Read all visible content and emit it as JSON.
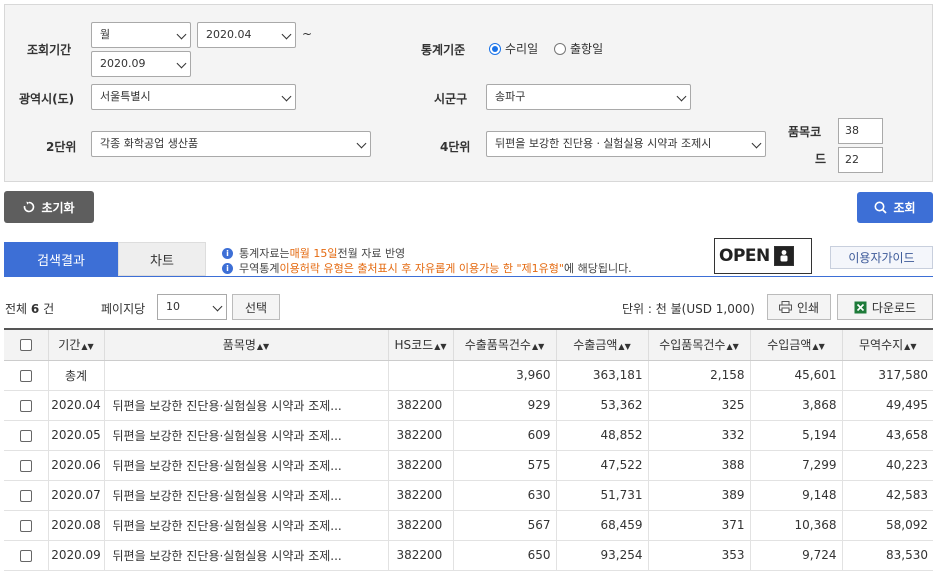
{
  "filters": {
    "period_label": "조회기간",
    "period_unit": "월",
    "period_start": "2020.04",
    "period_tilde": "~",
    "period_end": "2020.09",
    "stat_basis_label": "통계기준",
    "stat_basis_options": [
      "수리일",
      "출항일"
    ],
    "stat_basis_selected": "수리일",
    "province_label": "광역시(도)",
    "province_value": "서울특별시",
    "district_label": "시군구",
    "district_value": "송파구",
    "level2_label": "2단위",
    "level2_value": "각종 화학공업 생산품",
    "level4_label": "4단위",
    "level4_value": "뒤편을 보강한 진단용ㆍ실험실용 시약과 조제시",
    "item_code_label_1": "품목코",
    "item_code_label_2": "드",
    "item_code_1": "38",
    "item_code_2": "22"
  },
  "buttons": {
    "reset": "초기화",
    "search": "조회",
    "guide": "이용자가이드",
    "select": "선택",
    "print": "인쇄",
    "download": "다운로드"
  },
  "tabs": [
    "검색결과",
    "차트"
  ],
  "notices": {
    "line1_a": "통계자료는 ",
    "line1_b": "매월 15일",
    "line1_c": " 전월 자료 반영",
    "line2_a": "무역통계 ",
    "line2_b": "이용허락 유형은 출처표시 후 자유롭게 이용가능 한 \"제1유형\"",
    "line2_c": "에 해당됩니다."
  },
  "open_logo": {
    "word": "OPEN"
  },
  "summary": {
    "total_prefix": "전체",
    "total_count": "6",
    "total_suffix": "건",
    "per_page_label": "페이지당",
    "per_page_value": "10",
    "unit_text": "단위 : 천 불(USD 1,000)"
  },
  "table": {
    "headers": [
      "기간",
      "품목명",
      "HS코드",
      "수출품목건수",
      "수출금액",
      "수입품목건수",
      "수입금액",
      "무역수지"
    ],
    "total_row": {
      "period": "총계",
      "name": "",
      "hs": "",
      "exp_cnt": "3,960",
      "exp_amt": "363,181",
      "imp_cnt": "2,158",
      "imp_amt": "45,601",
      "balance": "317,580"
    },
    "rows": [
      {
        "period": "2020.04",
        "name": "뒤편을 보강한 진단용·실험실용 시약과 조제...",
        "hs": "382200",
        "exp_cnt": "929",
        "exp_amt": "53,362",
        "imp_cnt": "325",
        "imp_amt": "3,868",
        "balance": "49,495"
      },
      {
        "period": "2020.05",
        "name": "뒤편을 보강한 진단용·실험실용 시약과 조제...",
        "hs": "382200",
        "exp_cnt": "609",
        "exp_amt": "48,852",
        "imp_cnt": "332",
        "imp_amt": "5,194",
        "balance": "43,658"
      },
      {
        "period": "2020.06",
        "name": "뒤편을 보강한 진단용·실험실용 시약과 조제...",
        "hs": "382200",
        "exp_cnt": "575",
        "exp_amt": "47,522",
        "imp_cnt": "388",
        "imp_amt": "7,299",
        "balance": "40,223"
      },
      {
        "period": "2020.07",
        "name": "뒤편을 보강한 진단용·실험실용 시약과 조제...",
        "hs": "382200",
        "exp_cnt": "630",
        "exp_amt": "51,731",
        "imp_cnt": "389",
        "imp_amt": "9,148",
        "balance": "42,583"
      },
      {
        "period": "2020.08",
        "name": "뒤편을 보강한 진단용·실험실용 시약과 조제...",
        "hs": "382200",
        "exp_cnt": "567",
        "exp_amt": "68,459",
        "imp_cnt": "371",
        "imp_amt": "10,368",
        "balance": "58,092"
      },
      {
        "period": "2020.09",
        "name": "뒤편을 보강한 진단용·실험실용 시약과 조제...",
        "hs": "382200",
        "exp_cnt": "650",
        "exp_amt": "93,254",
        "imp_cnt": "353",
        "imp_amt": "9,724",
        "balance": "83,530"
      }
    ]
  },
  "colors": {
    "primary": "#3d6fd6",
    "reset_bg": "#5e5e5e",
    "accent_orange": "#e4690f",
    "excel_green": "#1e7b3a"
  }
}
